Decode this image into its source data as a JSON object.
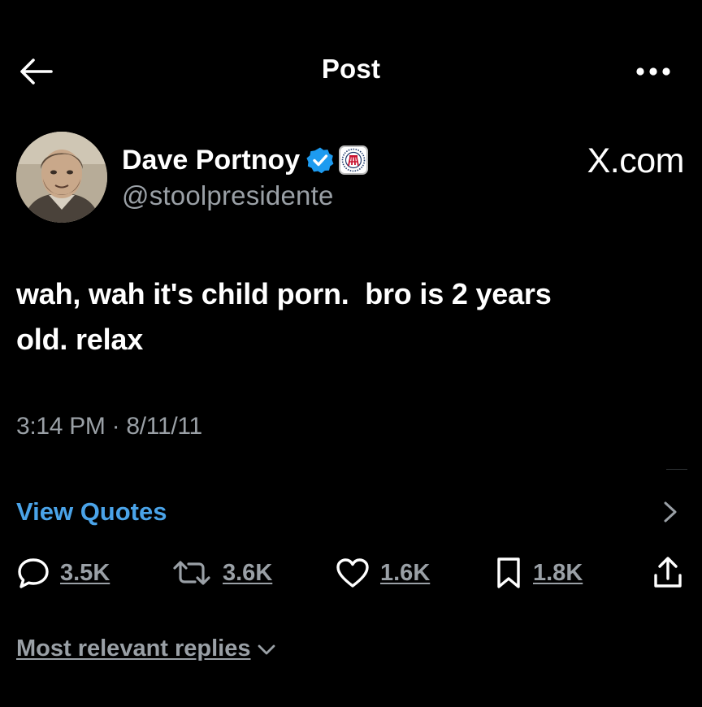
{
  "header": {
    "title": "Post",
    "back_icon": "arrow-left-icon",
    "more_icon": "more-horizontal-icon"
  },
  "author": {
    "display_name": "Dave Portnoy",
    "handle": "@stoolpresidente",
    "verified_icon": "verified-badge-icon",
    "affiliate_icon": "barstool-affiliate-badge-icon",
    "verified_color": "#1d9bf0"
  },
  "watermark": "X.com",
  "tweet": {
    "text": "wah, wah it's child porn.  bro is 2 years\nold. relax",
    "timestamp": "3:14 PM · 8/11/11"
  },
  "view_quotes": {
    "label": "View Quotes",
    "chevron_icon": "chevron-right-icon",
    "color": "#4aa3e8"
  },
  "actions": {
    "replies": {
      "icon": "reply-icon",
      "count": "3.5K"
    },
    "reposts": {
      "icon": "repost-icon",
      "count": "3.6K"
    },
    "likes": {
      "icon": "heart-icon",
      "count": "1.6K"
    },
    "bookmarks": {
      "icon": "bookmark-icon",
      "count": "1.8K"
    },
    "share": {
      "icon": "share-icon"
    }
  },
  "replies_sort": {
    "label": "Most relevant replies",
    "icon": "chevron-down-icon"
  },
  "colors": {
    "background": "#000000",
    "text": "#ffffff",
    "secondary_text": "#9aa0a6"
  }
}
